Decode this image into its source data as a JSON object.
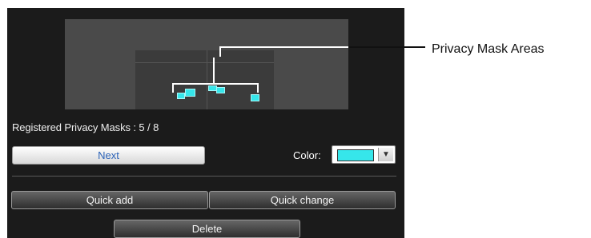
{
  "panel": {
    "status_label": "Registered Privacy Masks : 5 / 8",
    "next_label": "Next",
    "color_label": "Color:",
    "selected_color": "#36e6ea",
    "dropdown_icon": "triangle-down",
    "quick_add_label": "Quick add",
    "quick_change_label": "Quick change",
    "delete_label": "Delete"
  },
  "callout": {
    "label": "Privacy Mask Areas"
  },
  "colors": {
    "mask": "#36e6ea",
    "panel_bg": "#1b1b1b",
    "next_text": "#2c63b8"
  }
}
